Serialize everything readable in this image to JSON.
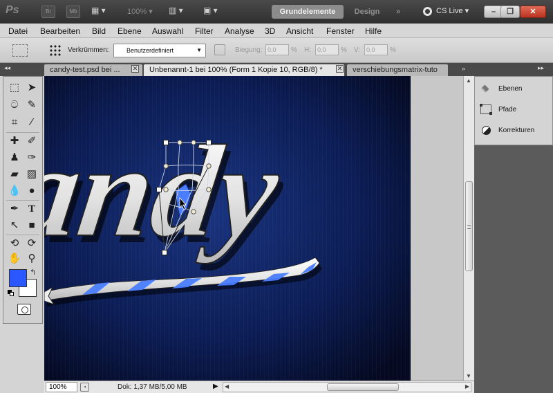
{
  "app": {
    "logo": "Ps",
    "bridge_label": "Br",
    "minibridge_label": "Mb",
    "zoom": "100%",
    "workspaces": {
      "active": "Grundelemente",
      "inactive": "Design",
      "more": "»"
    },
    "cs_live": "CS Live",
    "window_controls": {
      "minimize": "–",
      "restore": "❐",
      "close": "✕"
    }
  },
  "menu": [
    "Datei",
    "Bearbeiten",
    "Bild",
    "Ebene",
    "Auswahl",
    "Filter",
    "Analyse",
    "3D",
    "Ansicht",
    "Fenster",
    "Hilfe"
  ],
  "options": {
    "warp_label": "Verkrümmen:",
    "warp_value": "Benutzerdefiniert",
    "bend_label": "Biegung:",
    "bend_value": "0,0",
    "h_label": "H:",
    "h_value": "0,0",
    "v_label": "V:",
    "v_value": "0,0",
    "percent": "%"
  },
  "tabs": [
    {
      "label": "candy-test.psd bei ...",
      "active": false
    },
    {
      "label": "Unbenannt-1 bei 100% (Form 1 Kopie 10, RGB/8) *",
      "active": true
    },
    {
      "label": "verschiebungsmatrix-tuto",
      "active": false
    }
  ],
  "tab_close": "✕",
  "tab_overflow": "»",
  "panels": [
    {
      "label": "Ebenen",
      "icon": "layers-icon"
    },
    {
      "label": "Pfade",
      "icon": "paths-icon"
    },
    {
      "label": "Korrekturen",
      "icon": "adjustments-icon"
    }
  ],
  "status": {
    "zoom": "100%",
    "doc": "Dok: 1,37 MB/5,00 MB",
    "arrow": "▶"
  },
  "canvas_text": "andy",
  "colors": {
    "foreground": "#2a57ff",
    "background": "#ffffff",
    "canvas_bg": "#0d1b4a",
    "stripe_blue": "#4a7dff"
  }
}
